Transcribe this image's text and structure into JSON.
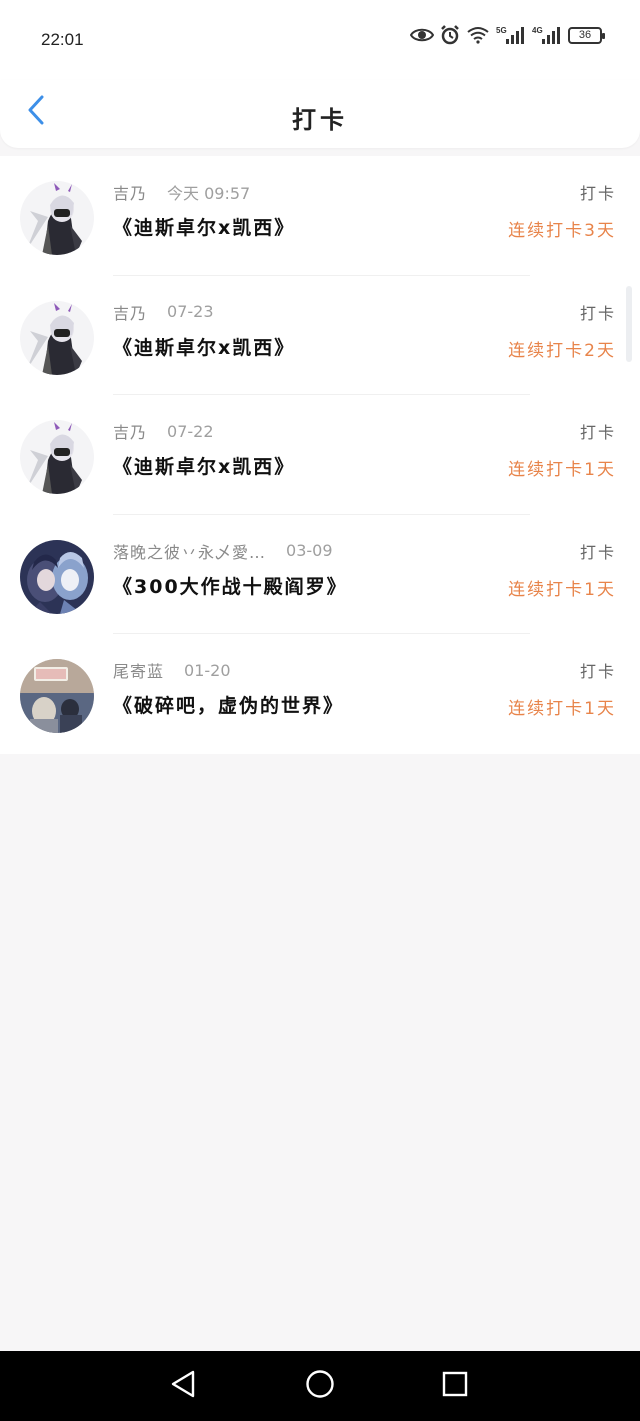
{
  "status_bar": {
    "time": "22:01",
    "icons": [
      "eye-icon",
      "alarm-icon",
      "wifi-icon",
      "signal-5g-icon",
      "signal-4g-icon",
      "battery-icon"
    ],
    "net1": "5G",
    "net2": "4G",
    "battery": "36"
  },
  "header": {
    "title": "打卡",
    "back_icon": "chevron-left-icon"
  },
  "colors": {
    "accent_back": "#3d8fe8",
    "streak": "#e8844a"
  },
  "checkins": [
    {
      "user": "吉乃",
      "time": "今天 09:57",
      "work": "《迪斯卓尔x凯西》",
      "action": "打卡",
      "streak": "连续打卡3天",
      "avatar": "avatar-anime-girl-dark"
    },
    {
      "user": "吉乃",
      "time": "07-23",
      "work": "《迪斯卓尔x凯西》",
      "action": "打卡",
      "streak": "连续打卡2天",
      "avatar": "avatar-anime-girl-dark"
    },
    {
      "user": "吉乃",
      "time": "07-22",
      "work": "《迪斯卓尔x凯西》",
      "action": "打卡",
      "streak": "连续打卡1天",
      "avatar": "avatar-anime-girl-dark"
    },
    {
      "user": "落晚之彼丷永乄愛…",
      "time": "03-09",
      "work": "《300大作战十殿阎罗》",
      "action": "打卡",
      "streak": "连续打卡1天",
      "avatar": "avatar-anime-duo-blue"
    },
    {
      "user": "尾寄蓝",
      "time": "01-20",
      "work": "《破碎吧，虚伪的世界》",
      "action": "打卡",
      "streak": "连续打卡1天",
      "avatar": "avatar-photo-slow"
    }
  ],
  "nav": {
    "back": "nav-back-icon",
    "home": "nav-home-icon",
    "recents": "nav-recents-icon"
  }
}
